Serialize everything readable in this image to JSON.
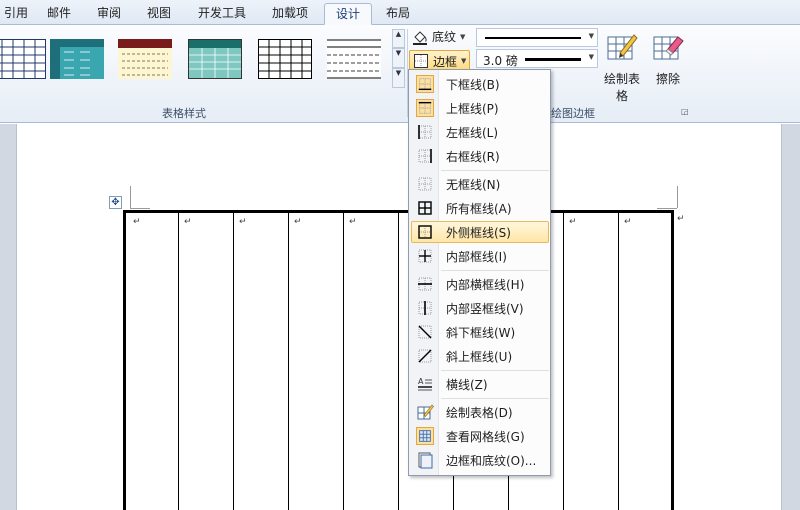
{
  "ribbon_tabs": [
    {
      "label": "引用"
    },
    {
      "label": "邮件"
    },
    {
      "label": "审阅"
    },
    {
      "label": "视图"
    },
    {
      "label": "开发工具"
    },
    {
      "label": "加载项"
    },
    {
      "label": "设计",
      "active": true
    },
    {
      "label": "布局"
    }
  ],
  "groups": {
    "table_styles": {
      "label": "表格样式"
    },
    "draw_borders": {
      "label": "绘图边框"
    }
  },
  "shading": {
    "label": "底纹",
    "icon": "paint-bucket-icon"
  },
  "borders": {
    "label": "边框",
    "icon": "border-grid-icon"
  },
  "pen": {
    "weight": "3.0 磅"
  },
  "draw_table": {
    "label": "绘制表格",
    "icon": "pencil-table-icon"
  },
  "eraser": {
    "label": "擦除",
    "icon": "eraser-icon"
  },
  "style_gallery": [
    {
      "name": "plain-grid",
      "accent": "#1f3a68"
    },
    {
      "name": "teal-shaded",
      "accent": "#1f7f83"
    },
    {
      "name": "maroon-header",
      "accent": "#7a1b1b"
    },
    {
      "name": "teal-grid",
      "accent": "#1b6f6b"
    },
    {
      "name": "black-grid",
      "accent": "#000000"
    },
    {
      "name": "simple-lines",
      "accent": "#000000"
    }
  ],
  "border_menu": {
    "items": [
      {
        "label": "下框线(B)",
        "icon": "bottom-border-icon",
        "boxed": true
      },
      {
        "label": "上框线(P)",
        "icon": "top-border-icon",
        "boxed": true
      },
      {
        "label": "左框线(L)",
        "icon": "left-border-icon"
      },
      {
        "label": "右框线(R)",
        "icon": "right-border-icon"
      },
      {
        "label": "无框线(N)",
        "icon": "no-border-icon"
      },
      {
        "label": "所有框线(A)",
        "icon": "all-borders-icon"
      },
      {
        "label": "外侧框线(S)",
        "icon": "outside-borders-icon",
        "hover": true
      },
      {
        "label": "内部框线(I)",
        "icon": "inside-borders-icon"
      },
      {
        "label": "内部横框线(H)",
        "icon": "inside-horizontal-border-icon"
      },
      {
        "label": "内部竖框线(V)",
        "icon": "inside-vertical-border-icon"
      },
      {
        "label": "斜下框线(W)",
        "icon": "diagonal-down-border-icon"
      },
      {
        "label": "斜上框线(U)",
        "icon": "diagonal-up-border-icon"
      },
      {
        "label": "横线(Z)",
        "icon": "horizontal-line-icon"
      },
      {
        "label": "绘制表格(D)",
        "icon": "draw-table-icon"
      },
      {
        "label": "查看网格线(G)",
        "icon": "view-gridlines-icon",
        "boxed": true
      },
      {
        "label": "边框和底纹(O)...",
        "icon": "borders-shading-icon"
      }
    ]
  },
  "document": {
    "paragraph_mark": "↵",
    "table_move_glyph": "✥"
  },
  "colors": {
    "menu_hover": "#ffe6a6",
    "active_tab_text": "#1a3f78",
    "ribbon_border": "#a9bcd6"
  }
}
